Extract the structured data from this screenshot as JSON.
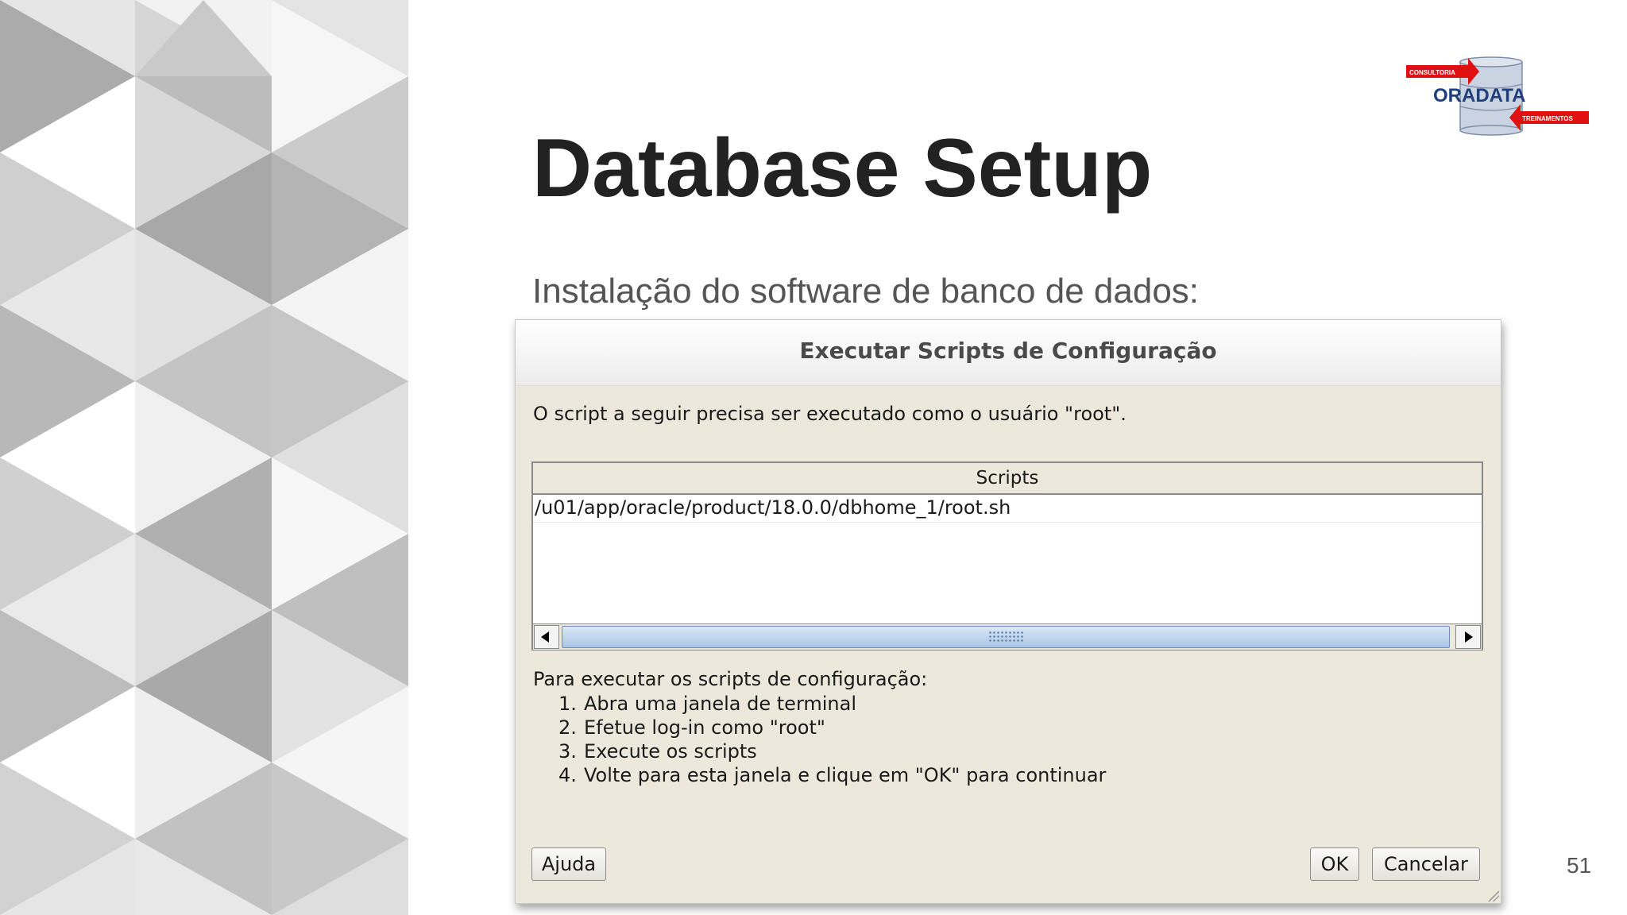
{
  "slide": {
    "title": "Database Setup",
    "subtitle": "Instalação do software de banco de dados:",
    "page_number": "51"
  },
  "logo": {
    "brand": "ORADATA",
    "tag_top": "CONSULTORIA",
    "tag_bottom": "TREINAMENTOS",
    "colors": {
      "brand_text": "#1f3e7a",
      "arrow": "#e01010",
      "cylinder": "#c9d3e2"
    }
  },
  "dialog": {
    "title": "Executar Scripts de Configuração",
    "intro": "O script a seguir precisa ser executado como o usuário \"root\".",
    "table": {
      "header": "Scripts",
      "rows": [
        "/u01/app/oracle/product/18.0.0/dbhome_1/root.sh"
      ]
    },
    "instructions_heading": "Para executar os scripts de configuração:",
    "steps": [
      {
        "num": "1.",
        "text": "Abra uma janela de terminal"
      },
      {
        "num": "2.",
        "text": "Efetue log-in como \"root\""
      },
      {
        "num": "3.",
        "text": "Execute os scripts"
      },
      {
        "num": "4.",
        "text": "Volte para esta janela e clique em \"OK\" para continuar"
      }
    ],
    "buttons": {
      "help": "Ajuda",
      "ok": "OK",
      "cancel": "Cancelar"
    }
  }
}
